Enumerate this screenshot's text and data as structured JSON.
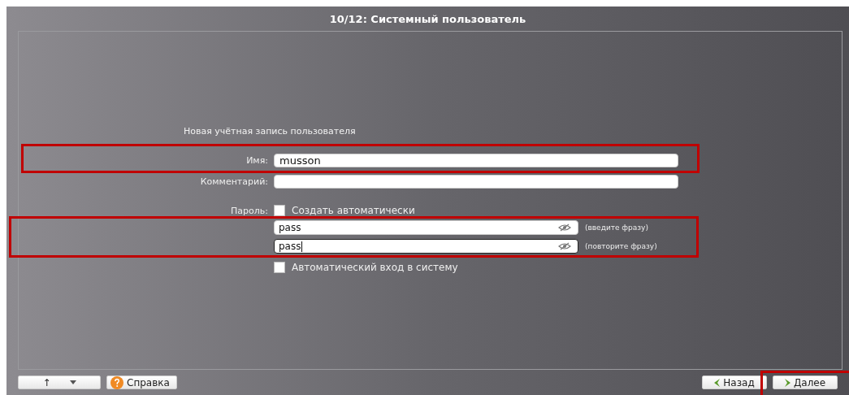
{
  "window": {
    "title": "10/12: Системный пользователь"
  },
  "section_title": "Новая учётная запись пользователя",
  "name": {
    "label": "Имя:",
    "value": "musson"
  },
  "comment": {
    "label": "Комментарий:"
  },
  "password": {
    "label": "Пароль:",
    "auto_generate": {
      "label": "Создать автоматически",
      "checked": false
    },
    "fields": [
      {
        "value": "pass",
        "hint": "(введите фразу)",
        "focused": false
      },
      {
        "value": "pass",
        "hint": "(повторите фразу)",
        "focused": true
      }
    ]
  },
  "auto_login": {
    "label": "Автоматический вход в систему",
    "checked": false
  },
  "footer": {
    "up_button": "↑",
    "help_button": "Справка",
    "back_button": "Назад",
    "next_button": "Далее"
  }
}
